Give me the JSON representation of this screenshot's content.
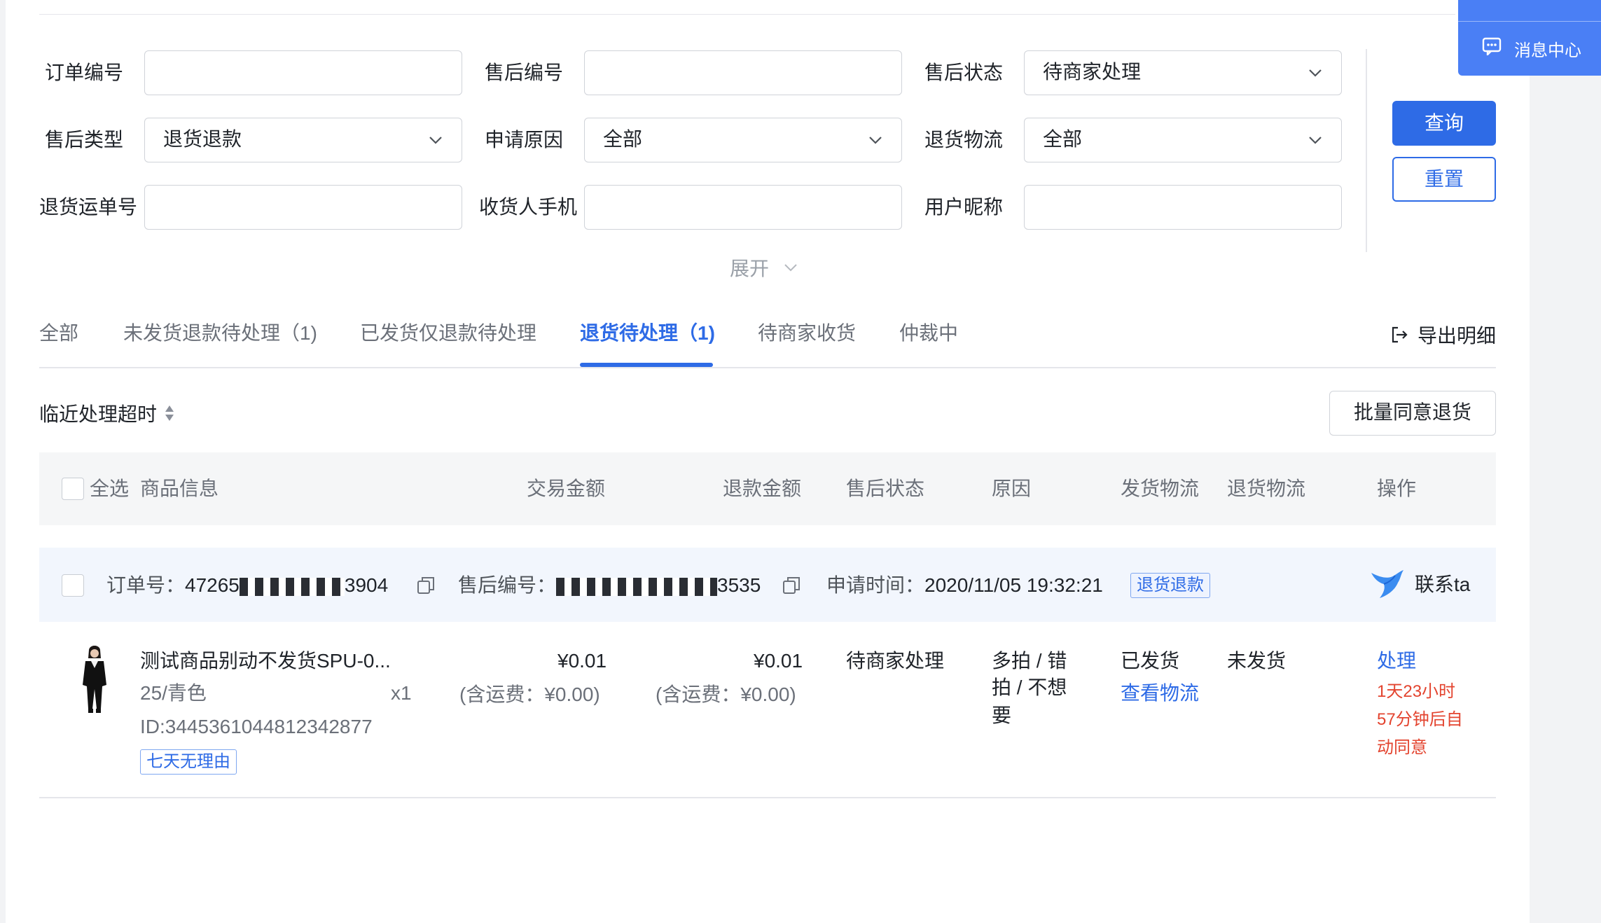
{
  "message_center": {
    "label": "消息中心"
  },
  "filters": {
    "order_no": {
      "label": "订单编号",
      "value": ""
    },
    "aftersale_no": {
      "label": "售后编号",
      "value": ""
    },
    "aftersale_status": {
      "label": "售后状态",
      "value": "待商家处理"
    },
    "aftersale_type": {
      "label": "售后类型",
      "value": "退货退款"
    },
    "apply_reason": {
      "label": "申请原因",
      "value": "全部"
    },
    "return_logistics": {
      "label": "退货物流",
      "value": "全部"
    },
    "return_tracking_no": {
      "label": "退货运单号",
      "value": ""
    },
    "receiver_phone": {
      "label": "收货人手机",
      "value": ""
    },
    "user_nickname": {
      "label": "用户昵称",
      "value": ""
    },
    "query_button": "查询",
    "reset_button": "重置",
    "expand": "展开"
  },
  "tabs": [
    {
      "label": "全部",
      "active": false
    },
    {
      "label": "未发货退款待处理（1)",
      "active": false
    },
    {
      "label": "已发货仅退款待处理",
      "active": false
    },
    {
      "label": "退货待处理（1)",
      "active": true
    },
    {
      "label": "待商家收货",
      "active": false
    },
    {
      "label": "仲裁中",
      "active": false
    }
  ],
  "export_label": "导出明细",
  "sort_label": "临近处理超时",
  "batch_button": "批量同意退货",
  "table_header": {
    "select_all": "全选",
    "product_info": "商品信息",
    "trade_amount": "交易金额",
    "refund_amount": "退款金额",
    "aftersale_status": "售后状态",
    "reason": "原因",
    "ship_logistics": "发货物流",
    "return_logistics": "退货物流",
    "operation": "操作"
  },
  "order": {
    "order_no_label": "订单号：",
    "order_no_prefix": "47265",
    "order_no_suffix": "3904",
    "aftersale_no_label": "售后编号：",
    "aftersale_no_suffix": "3535",
    "apply_time_label": "申请时间：",
    "apply_time": "2020/11/05 19:32:21",
    "type_tag": "退货退款",
    "contact": "联系ta",
    "product": {
      "title": "测试商品别动不发货SPU-0...",
      "spec": "25/青色",
      "quantity": "x1",
      "id": "ID:3445361044812342877",
      "tag": "七天无理由"
    },
    "trade_amount": "¥0.01",
    "trade_shipping": "(含运费：¥0.00)",
    "refund_amount": "¥0.01",
    "refund_shipping": "(含运费：¥0.00)",
    "status": "待商家处理",
    "reason_lines": [
      "多拍 / 错",
      "拍 / 不想",
      "要"
    ],
    "ship_status": "已发货",
    "view_logistics": "查看物流",
    "return_status": "未发货",
    "action": "处理",
    "countdown_lines": [
      "1天23小时",
      "57分钟后自",
      "动同意"
    ]
  }
}
